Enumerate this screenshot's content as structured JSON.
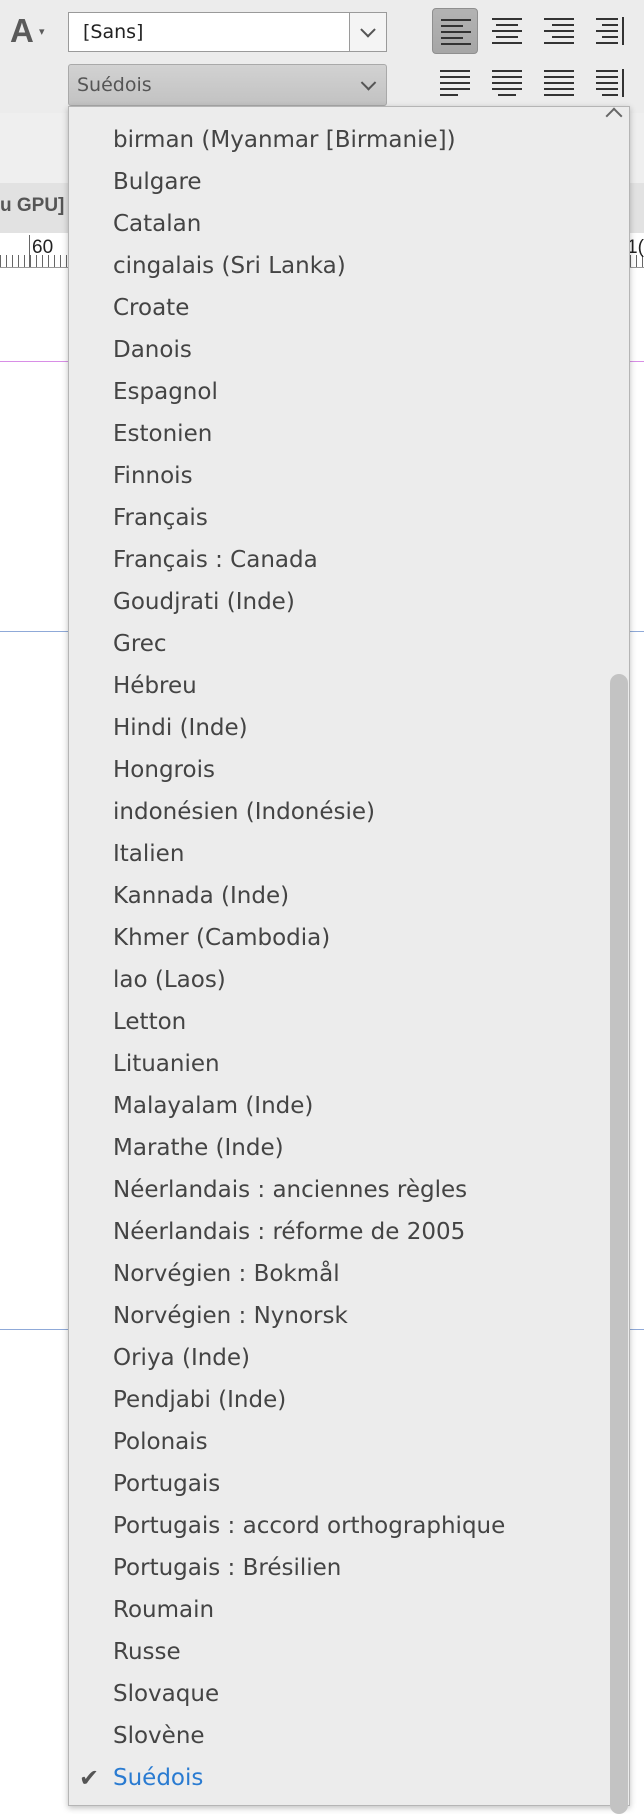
{
  "toolbar": {
    "char_icon": "A.",
    "font_style_value": "[Sans]",
    "language_value": "Suédois",
    "align_buttons": [
      {
        "name": "align-left-icon",
        "selected": true
      },
      {
        "name": "align-center-icon",
        "selected": false
      },
      {
        "name": "align-right-icon",
        "selected": false
      },
      {
        "name": "align-towards-spine-icon",
        "selected": false
      },
      {
        "name": "justify-left-icon",
        "selected": false
      },
      {
        "name": "justify-center-icon",
        "selected": false
      },
      {
        "name": "justify-all-icon",
        "selected": false
      },
      {
        "name": "justify-away-spine-icon",
        "selected": false
      }
    ]
  },
  "document": {
    "window_title_partial": "u GPU]",
    "ruler_label": "60",
    "ruler_label_right": "1(",
    "guide_colors": {
      "magenta": "#d88ee6",
      "blue": "#8fa9d8"
    }
  },
  "language_list": {
    "items": [
      "birman (Myanmar [Birmanie])",
      "Bulgare",
      "Catalan",
      "cingalais (Sri Lanka)",
      "Croate",
      "Danois",
      "Espagnol",
      "Estonien",
      "Finnois",
      "Français",
      "Français : Canada",
      "Goudjrati (Inde)",
      "Grec",
      "Hébreu",
      "Hindi (Inde)",
      "Hongrois",
      "indonésien (Indonésie)",
      "Italien",
      "Kannada (Inde)",
      "Khmer (Cambodia)",
      "lao (Laos)",
      "Letton",
      "Lituanien",
      "Malayalam (Inde)",
      "Marathe (Inde)",
      "Néerlandais : anciennes règles",
      "Néerlandais : réforme de 2005",
      "Norvégien : Bokmål",
      "Norvégien : Nynorsk",
      "Oriya (Inde)",
      "Pendjabi (Inde)",
      "Polonais",
      "Portugais",
      "Portugais : accord orthographique",
      "Portugais : Brésilien",
      "Roumain",
      "Russe",
      "Slovaque",
      "Slovène",
      "Suédois"
    ],
    "selected": "Suédois",
    "check_glyph": "✔",
    "selected_color": "#2a7bd1"
  }
}
